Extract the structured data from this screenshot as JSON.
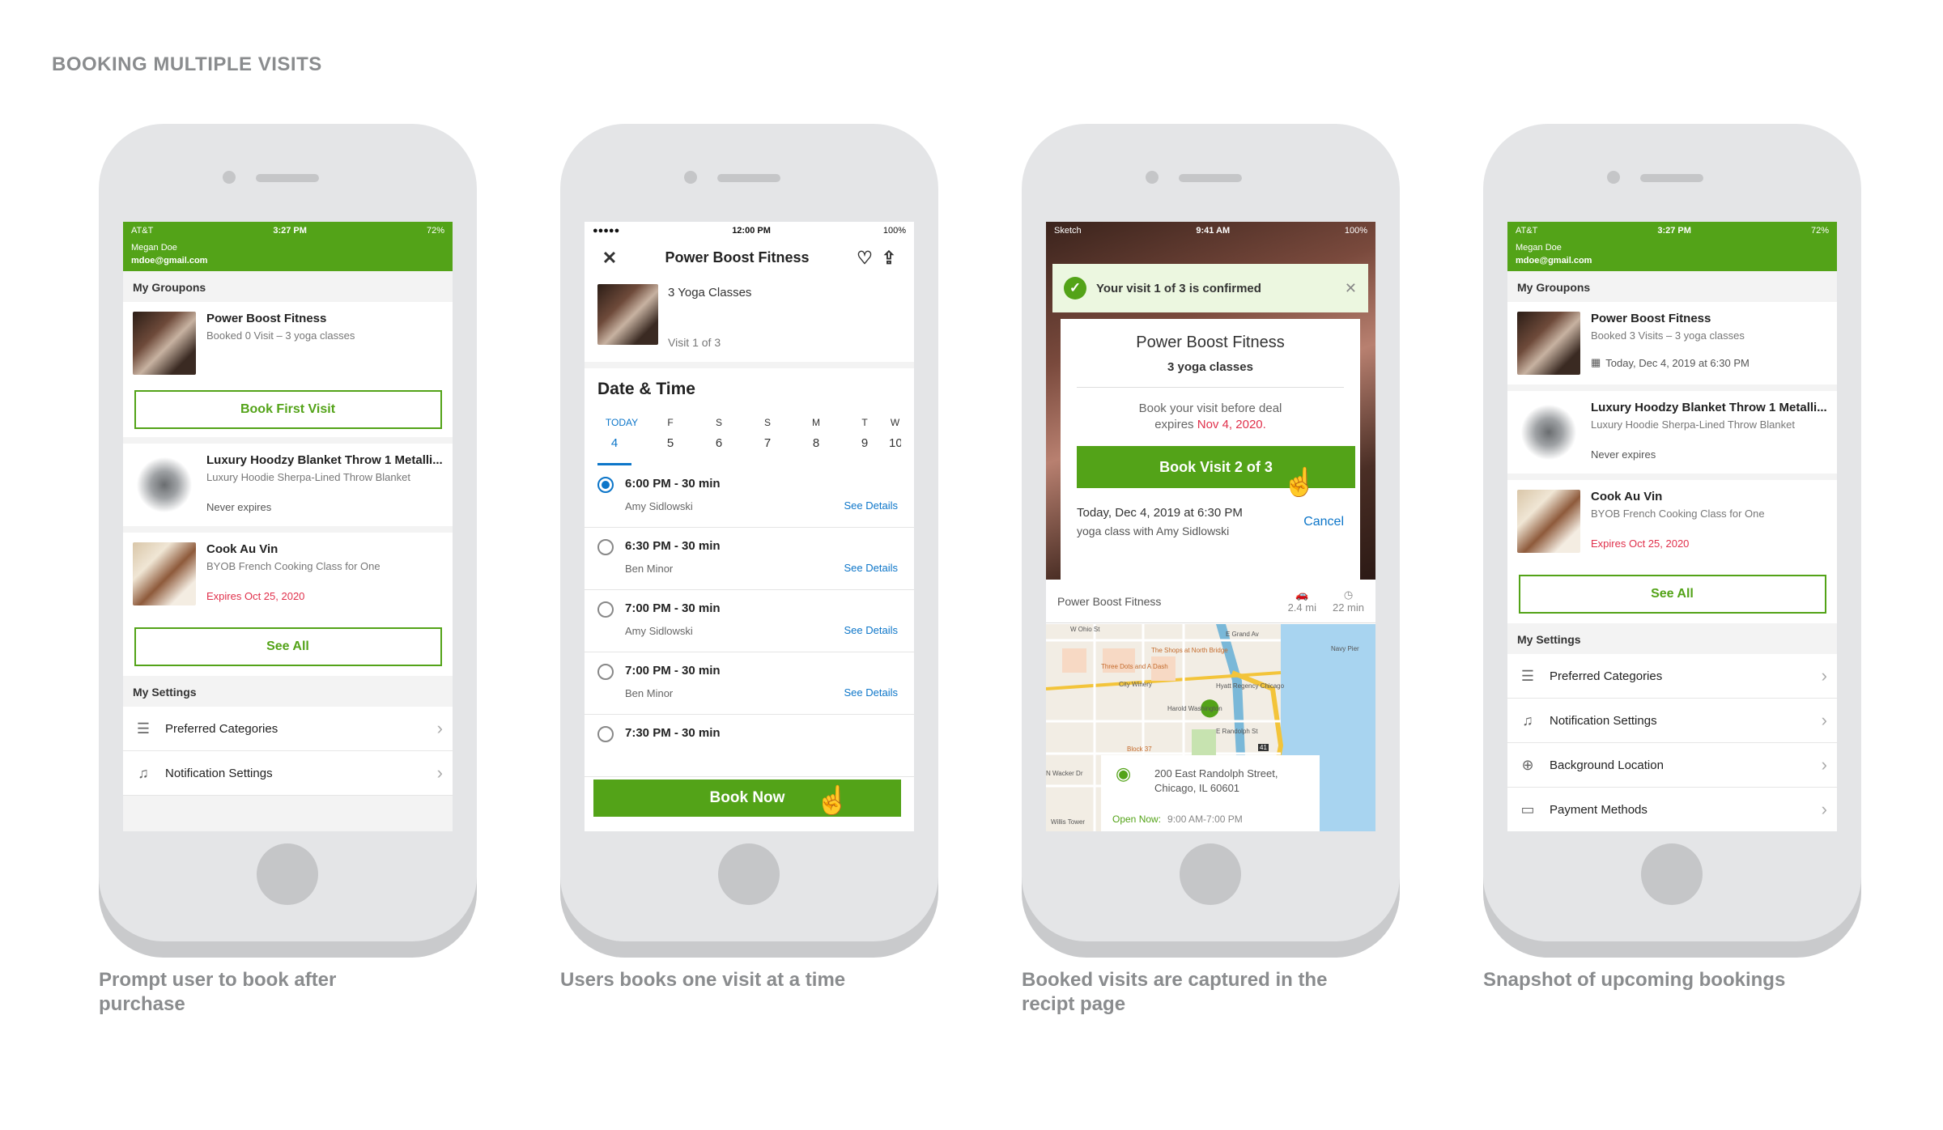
{
  "title": "BOOKING MULTIPLE VISITS",
  "phones": [
    {
      "caption": "Prompt user to book after purchase"
    },
    {
      "caption": "Users books one visit at a time"
    },
    {
      "caption": "Booked visits are captured in the recipt page"
    },
    {
      "caption": "Snapshot of upcoming bookings"
    }
  ],
  "s1": {
    "status": {
      "carrier": "AT&T",
      "time": "3:27 PM",
      "battery": "72%"
    },
    "user": {
      "name": "Megan Doe",
      "email": "mdoe@gmail.com"
    },
    "groupons_label": "My Groupons",
    "cards": [
      {
        "title": "Power Boost Fitness",
        "sub": "Booked 0 Visit – 3 yoga classes"
      },
      {
        "title": "Luxury Hoodzy Blanket Throw 1 Metalli...",
        "sub": "Luxury Hoodie Sherpa-Lined Throw Blanket",
        "extra": "Never expires"
      },
      {
        "title": "Cook Au Vin",
        "sub": "BYOB French Cooking Class for One",
        "extra": "Expires Oct 25, 2020"
      }
    ],
    "book_first_visit": "Book First Visit",
    "see_all": "See All",
    "settings_label": "My Settings",
    "settings": [
      "Preferred Categories",
      "Notification Settings"
    ]
  },
  "s2": {
    "status": {
      "time": "12:00 PM",
      "battery": "100%"
    },
    "title": "Power Boost Fitness",
    "deal": {
      "name": "3 Yoga Classes",
      "visit": "Visit 1 of 3"
    },
    "date_time_label": "Date & Time",
    "days": [
      {
        "d": "TODAY",
        "n": "4"
      },
      {
        "d": "F",
        "n": "5"
      },
      {
        "d": "S",
        "n": "6"
      },
      {
        "d": "S",
        "n": "7"
      },
      {
        "d": "M",
        "n": "8"
      },
      {
        "d": "T",
        "n": "9"
      },
      {
        "d": "W",
        "n": "10"
      }
    ],
    "slots": [
      {
        "time": "6:00 PM - 30 min",
        "who": "Amy Sidlowski",
        "link": "See Details"
      },
      {
        "time": "6:30 PM - 30 min",
        "who": "Ben Minor",
        "link": "See Details"
      },
      {
        "time": "7:00 PM - 30 min",
        "who": "Amy Sidlowski",
        "link": "See Details"
      },
      {
        "time": "7:00 PM - 30 min",
        "who": "Ben Minor",
        "link": "See Details"
      },
      {
        "time": "7:30 PM - 30 min",
        "who": "",
        "link": ""
      }
    ],
    "book_now": "Book Now"
  },
  "s3": {
    "status": {
      "carrier": "Sketch",
      "time": "9:41 AM",
      "battery": "100%"
    },
    "toast": "Your visit 1 of 3  is confirmed",
    "merchant": "Power Boost Fitness",
    "classes": "3 yoga classes",
    "book_before": "Book your visit before deal",
    "expires_prefix": "expires",
    "expires_date": "Nov 4, 2020.",
    "book_visit": "Book Visit 2 of 3",
    "when": "Today, Dec 4, 2019 at 6:30 PM",
    "class_with": "yoga class with Amy Sidlowski",
    "cancel": "Cancel",
    "map_title": "Power Boost Fitness",
    "drive": "2.4 mi",
    "walk": "22 min",
    "address_1": "200 East Randolph Street,",
    "address_2": "Chicago, IL 60601",
    "open_now": "Open Now:",
    "hours": "9:00 AM-7:00 PM",
    "map_labels": [
      "W Ohio St",
      "The Shops at North Bridge",
      "E Grand Av",
      "Navy Pier",
      "Three Dots and A Dash",
      "City Winery",
      "Hyatt Regency Chicago",
      "Harold Washington",
      "E Randolph St",
      "Block 37",
      "Willis Tower",
      "N Wacker Dr",
      "41"
    ]
  },
  "s4": {
    "status": {
      "carrier": "AT&T",
      "time": "3:27 PM",
      "battery": "72%"
    },
    "user": {
      "name": "Megan Doe",
      "email": "mdoe@gmail.com"
    },
    "groupons_label": "My Groupons",
    "cards": [
      {
        "title": "Power Boost Fitness",
        "sub": "Booked 3 Visits – 3 yoga classes",
        "extra": "Today, Dec 4, 2019 at 6:30 PM"
      },
      {
        "title": "Luxury Hoodzy Blanket Throw 1 Metalli...",
        "sub": "Luxury Hoodie Sherpa-Lined Throw Blanket",
        "extra": "Never expires"
      },
      {
        "title": "Cook Au Vin",
        "sub": "BYOB French Cooking Class for One",
        "extra": "Expires Oct 25, 2020"
      }
    ],
    "see_all": "See All",
    "settings_label": "My Settings",
    "settings": [
      "Preferred Categories",
      "Notification Settings",
      "Background Location",
      "Payment Methods"
    ]
  },
  "colors": {
    "brand_green": "#53a318",
    "link_blue": "#0d76c9",
    "alert_red": "#e0304b"
  }
}
